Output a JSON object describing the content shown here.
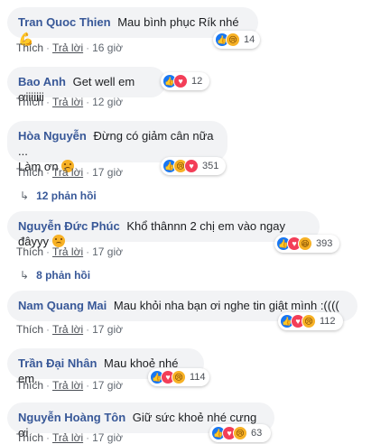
{
  "action_like": "Thích",
  "action_reply": "Trả lời",
  "separator": "·",
  "comments": [
    {
      "author": "Tran Quoc Thien",
      "text": "Mau bình phục Rík nhé",
      "emoji": "flexed-biceps",
      "time": "16 giờ",
      "reactions": [
        "like",
        "sad"
      ],
      "count": "14"
    },
    {
      "author": "Bao Anh",
      "text": "Get well em ơiiiiiii",
      "time": "12 giờ",
      "reactions": [
        "like",
        "love"
      ],
      "count": "12"
    },
    {
      "author": "Hòa Nguyễn",
      "text": "Đừng có giảm cân nữa ...",
      "text2": "Làm ơn",
      "emoji": "sad-face",
      "time": "17 giờ",
      "reactions": [
        "like",
        "sad",
        "love"
      ],
      "count": "351",
      "replies": "12 phản hồi"
    },
    {
      "author": "Nguyễn Đức Phúc",
      "text": "Khổ thânnn 2 chị em vào ngay đâyyy",
      "emoji": "sad-face",
      "time": "17 giờ",
      "reactions": [
        "like",
        "love",
        "haha"
      ],
      "count": "393",
      "replies": "8 phản hồi"
    },
    {
      "author": "Nam Quang Mai",
      "text": "Mau khỏi nha bạn ơi nghe tin giật mình :((((",
      "time": "17 giờ",
      "reactions": [
        "like",
        "love",
        "sad"
      ],
      "count": "112"
    },
    {
      "author": "Trần Đại Nhân",
      "text": "Mau khoẻ nhé em.",
      "time": "17 giờ",
      "reactions": [
        "like",
        "love",
        "sad"
      ],
      "count": "114"
    },
    {
      "author": "Nguyễn Hoàng Tôn",
      "text": "Giữ sức khoẻ nhé cưng ơi",
      "time": "17 giờ",
      "reactions": [
        "like",
        "love",
        "sad"
      ],
      "count": "63"
    }
  ],
  "colors": {
    "bubble": "#f2f3f5",
    "author": "#385898",
    "like": "#1877f2",
    "love": "#f33e58",
    "sad": "#f7b125"
  }
}
